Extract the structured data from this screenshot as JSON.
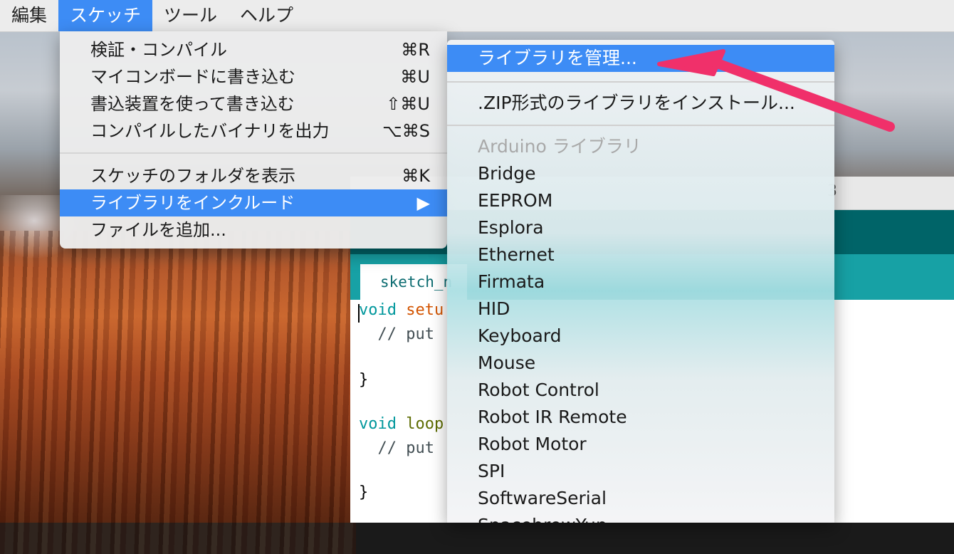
{
  "menubar": {
    "items": [
      {
        "label": "編集"
      },
      {
        "label": "スケッチ"
      },
      {
        "label": "ツール"
      },
      {
        "label": "ヘルプ"
      }
    ]
  },
  "sketch_menu": {
    "items": [
      {
        "label": "検証・コンパイル",
        "shortcut": "⌘R"
      },
      {
        "label": "マイコンボードに書き込む",
        "shortcut": "⌘U"
      },
      {
        "label": "書込装置を使って書き込む",
        "shortcut": "⇧⌘U"
      },
      {
        "label": "コンパイルしたバイナリを出力",
        "shortcut": "⌥⌘S"
      },
      {
        "label": "スケッチのフォルダを表示",
        "shortcut": "⌘K"
      },
      {
        "label": "ライブラリをインクルード",
        "shortcut": "▶"
      },
      {
        "label": "ファイルを追加..."
      }
    ]
  },
  "library_submenu": {
    "manage": "ライブラリを管理...",
    "install_zip": ".ZIP形式のライブラリをインストール...",
    "section_header": "Arduino ライブラリ",
    "libraries": [
      "Bridge",
      "EEPROM",
      "Esplora",
      "Ethernet",
      "Firmata",
      "HID",
      "Keyboard",
      "Mouse",
      "Robot Control",
      "Robot IR Remote",
      "Robot Motor",
      "SPI",
      "SoftwareSerial",
      "SpacebrewYun"
    ]
  },
  "ide": {
    "title_fragment": "3",
    "tab_label": "sketch_n",
    "code": {
      "line1_kw": "void",
      "line1_fn": " setu",
      "line2": "  // put",
      "line4": "}",
      "line6_kw": "void",
      "line6_fn": " loop",
      "line7": "  // put",
      "line9": "}"
    }
  },
  "colors": {
    "highlight": "#3d8cf5",
    "ide_toolbar": "#006468",
    "ide_tabs": "#17a1a5",
    "annotation_arrow": "#f0306a"
  }
}
